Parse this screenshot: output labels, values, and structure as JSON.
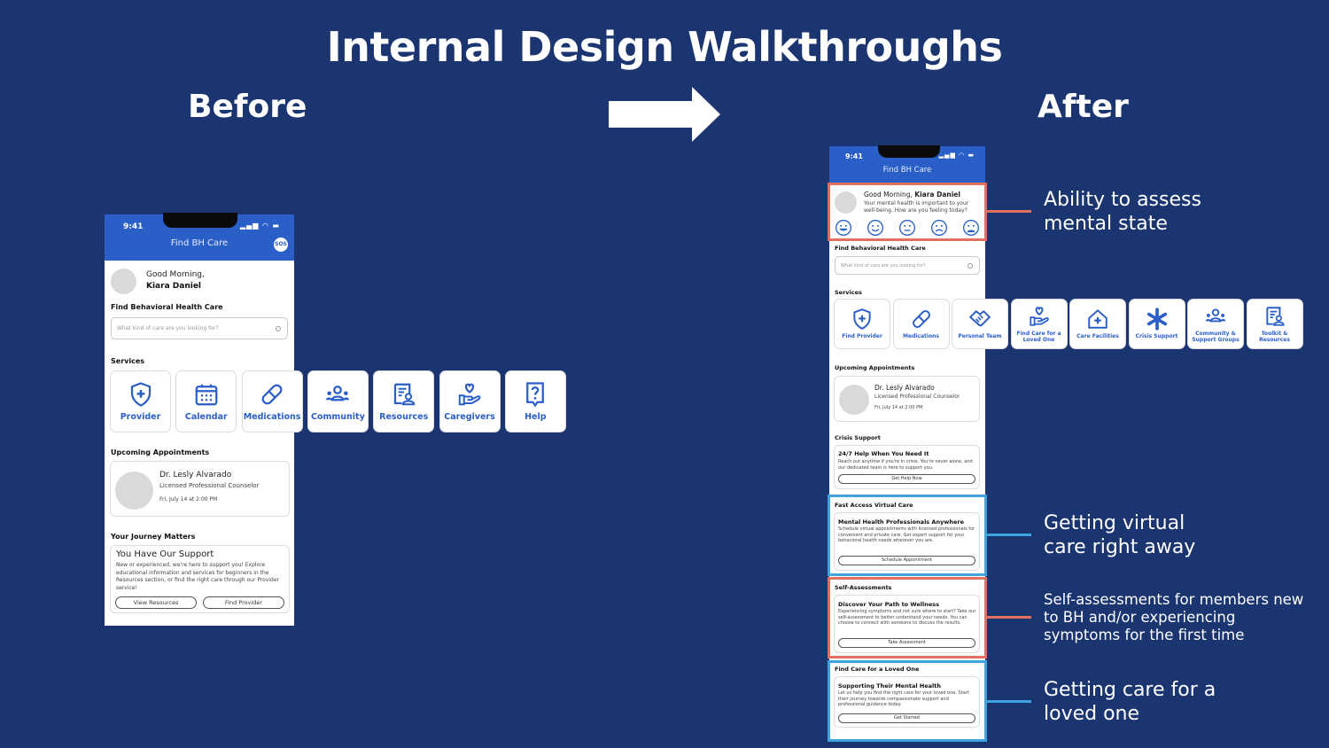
{
  "slide": {
    "title": "Internal Design Walkthroughs",
    "before_label": "Before",
    "after_label": "After",
    "arrow_icon": "arrow-right-icon",
    "colors": {
      "background": "#1b3570",
      "brand_blue": "#2b5fc8",
      "highlight_red": "#e07060",
      "highlight_blue": "#3fa3e0"
    }
  },
  "before": {
    "status_time": "9:41",
    "header_title": "Find BH Care",
    "sos_label": "SOS",
    "greeting": "Good Morning,",
    "user_name": "Kiara Daniel",
    "find_heading": "Find Behavioral Health Care",
    "search_placeholder": "What kind of care are you looking for?",
    "services_heading": "Services",
    "services": [
      {
        "label": "Provider",
        "icon": "shield-plus-icon"
      },
      {
        "label": "Calendar",
        "icon": "calendar-icon"
      },
      {
        "label": "Medications",
        "icon": "pill-icon"
      },
      {
        "label": "Community",
        "icon": "people-icon"
      },
      {
        "label": "Resources",
        "icon": "document-person-icon"
      },
      {
        "label": "Caregivers",
        "icon": "hand-heart-icon"
      },
      {
        "label": "Help",
        "icon": "question-bubble-icon"
      }
    ],
    "appointments_heading": "Upcoming Appointments",
    "appointment": {
      "doctor": "Dr. Lesly Alvarado",
      "role": "Licensed Professional Counselor",
      "when": "Fri, July 14 at 2:00 PM"
    },
    "journey_heading": "Your Journey Matters",
    "journey_card": {
      "title": "You Have Our Support",
      "body": "New or experienced, we're here to support you! Explore educational information and services for beginners in the Resources section, or find the right care through our Provider service!",
      "button_1": "View Resources",
      "button_2": "Find Provider"
    }
  },
  "after": {
    "status_time": "9:41",
    "header_title": "Find BH Care",
    "greeting": "Good Morning,",
    "user_name": "Kiara Daniel",
    "mood_prompt": "Your mental health is important to your well-being. How are you feeling today?",
    "moods": [
      "very-happy-face-icon",
      "happy-face-icon",
      "neutral-face-icon",
      "sad-face-icon",
      "very-sad-face-icon"
    ],
    "find_heading": "Find Behavioral Health Care",
    "search_placeholder": "What kind of care are you looking for?",
    "services_heading": "Services",
    "services": [
      {
        "label": "Find Provider",
        "icon": "shield-plus-icon"
      },
      {
        "label": "Medications",
        "icon": "pill-icon"
      },
      {
        "label": "Personal Team",
        "icon": "handshake-icon"
      },
      {
        "label": "Find Care for a Loved One",
        "icon": "hand-heart-icon"
      },
      {
        "label": "Care Facilities",
        "icon": "house-plus-icon"
      },
      {
        "label": "Crisis Support",
        "icon": "asterisk-icon"
      },
      {
        "label": "Community & Support Groups",
        "icon": "people-icon"
      },
      {
        "label": "Toolkit & Resources",
        "icon": "document-person-icon"
      }
    ],
    "appointments_heading": "Upcoming Appointments",
    "appointment": {
      "doctor": "Dr. Lesly Alvarado",
      "role": "Licensed Professional Counselor",
      "when": "Fri, July 14 at 2:00 PM"
    },
    "crisis": {
      "heading": "Crisis Support",
      "title": "24/7 Help When You Need It",
      "body": "Reach out anytime if you're in crisis. You're never alone, and our dedicated team is here to support you.",
      "button": "Get Help Now"
    },
    "virtual": {
      "heading": "Fast Access Virtual Care",
      "title": "Mental Health Professionals Anywhere",
      "body": "Schedule virtual appointments with licensed professionals for convenient and private care. Get expert support for your behavioral health needs wherever you are.",
      "button": "Schedule Appointment"
    },
    "assessment": {
      "heading": "Self-Assessments",
      "title": "Discover Your Path to Wellness",
      "body": "Experiencing symptoms and not sure where to start? Take our self-assessment to better understand your needs. You can choose to connect with someone to discuss the results.",
      "button": "Take Assessment"
    },
    "loved_one": {
      "heading": "Find Care for a Loved One",
      "title": "Supporting Their Mental Health",
      "body": "Let us help you find the right care for your loved one. Start their journey towards compassionate support and professional guidance today.",
      "button": "Get Started"
    }
  },
  "annotations": [
    {
      "text": "Ability to assess mental state",
      "color": "red"
    },
    {
      "text": "Getting virtual care right away",
      "color": "blue"
    },
    {
      "text": "Self-assessments for members new to BH and/or experiencing symptoms for the first time",
      "color": "red"
    },
    {
      "text": "Getting care for a loved one",
      "color": "blue"
    }
  ]
}
